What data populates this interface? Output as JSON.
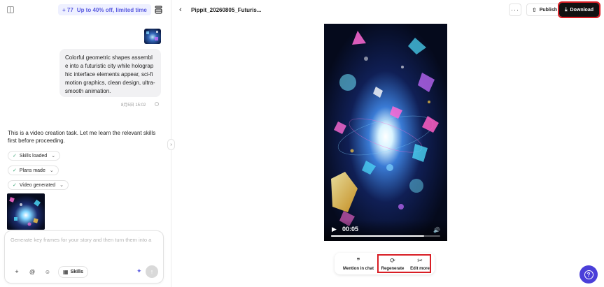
{
  "promo": {
    "count": "+ 77",
    "offer": "Up to 40% off, limited time"
  },
  "chat": {
    "prompt_text": "Colorful geometric shapes assemble into a futuristic city while holographic interface elements appear, sci-fi motion graphics, clean design, ultra-smooth animation.",
    "prompt_time": "8月5日 15:02",
    "assistant_text": "This is a video creation task. Let me learn the relevant skills first before proceeding.",
    "steps": [
      {
        "label": "Skills loaded"
      },
      {
        "label": "Plans made"
      },
      {
        "label": "Video generated"
      }
    ]
  },
  "composer": {
    "placeholder": "Generate key frames for your story and then turn them into a",
    "skills_label": "Skills"
  },
  "header": {
    "file_title": "Pippit_20260805_Futuris...",
    "more_label": "···",
    "publish_label": "Publish",
    "download_label": "Download"
  },
  "player": {
    "time": "00:05",
    "progress": 0.85
  },
  "actions": {
    "mention_label": "Mention in chat",
    "regenerate_label": "Regenerate",
    "edit_more_label": "Edit more"
  },
  "colors": {
    "accent": "#5b5ce0",
    "highlight": "#d81e25",
    "fab": "#4b3fd9"
  }
}
